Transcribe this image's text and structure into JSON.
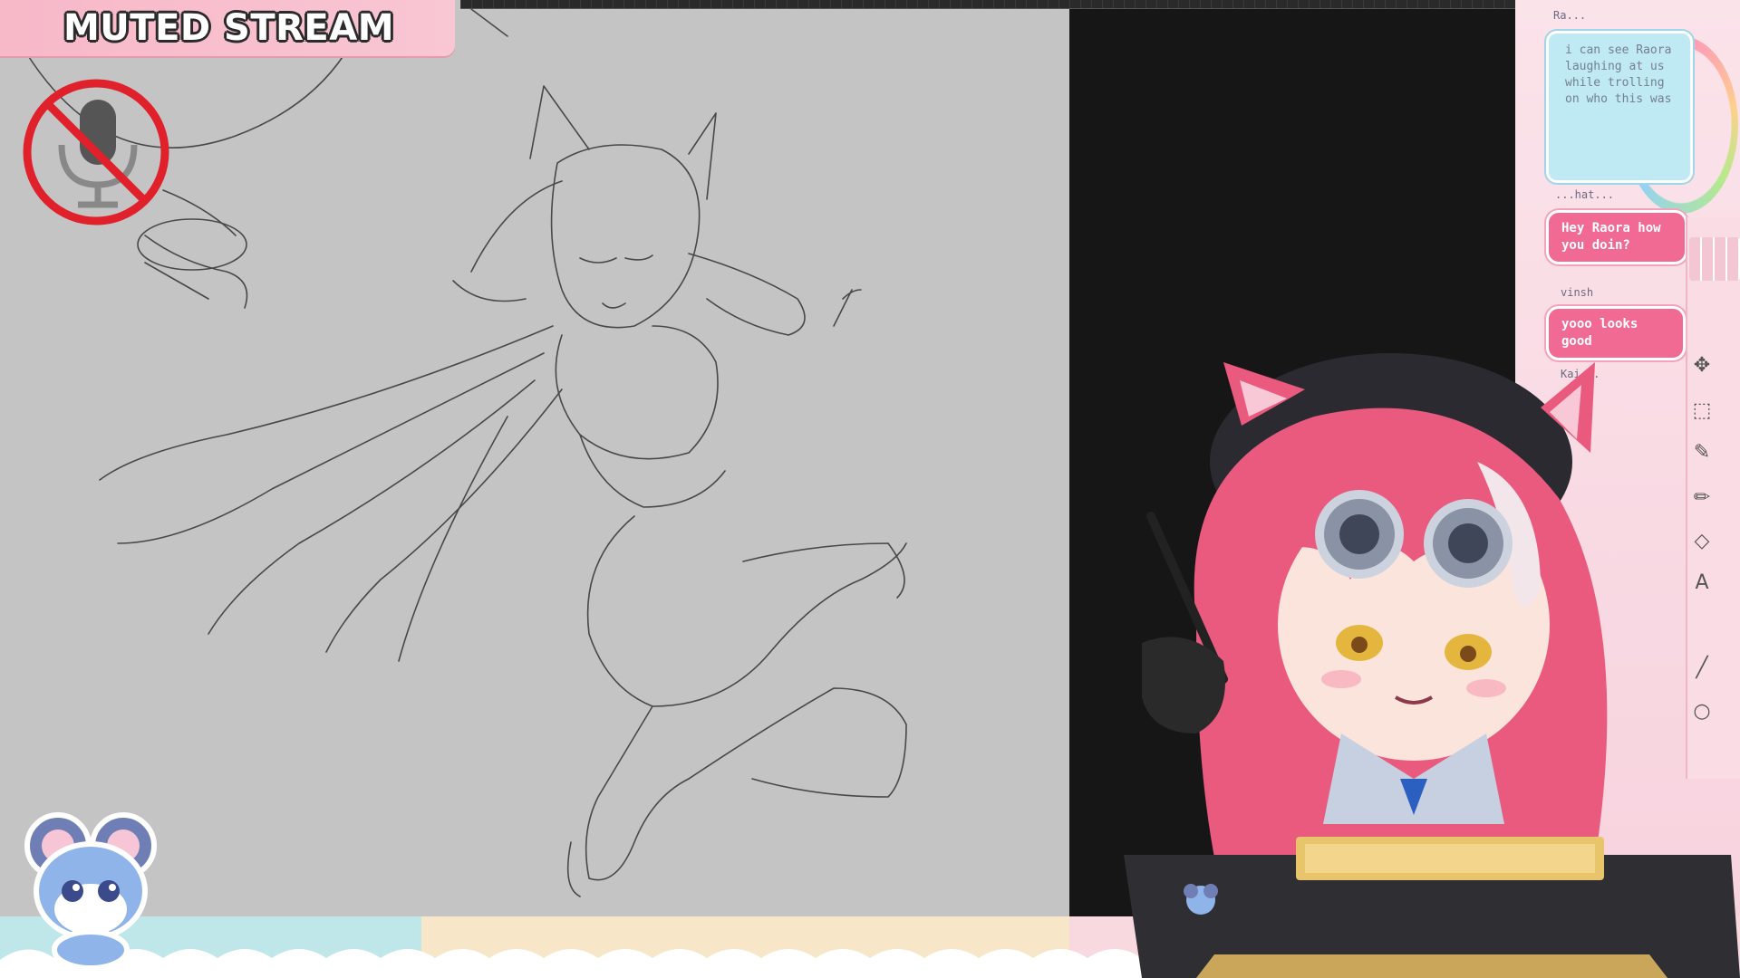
{
  "banner": {
    "text": "MUTED STREAM"
  },
  "chat": {
    "card": {
      "user": "Ra...",
      "message": "i can see Raora laughing at us while trolling on who this was"
    },
    "messages": [
      {
        "user": "...hat...",
        "text": "Hey Raora how you doin?"
      },
      {
        "user": "vinsh",
        "text": "yooo looks good"
      },
      {
        "user": "Kai...",
        "text": ""
      }
    ]
  },
  "icons": {
    "muted": "microphone-muted-icon",
    "mascot": "blue-mouse-mascot",
    "tools": [
      "move-icon",
      "select-rect-icon",
      "eyedropper-icon",
      "pen-icon",
      "eraser-icon",
      "text-icon",
      "line-icon",
      "circle-icon"
    ]
  },
  "colors": {
    "banner": "#f7b8c8",
    "canvas": "#c4c4c4",
    "chat_bubble": "#f06a93",
    "chat_card": "#bfe9f3",
    "hair": "#e95a7e"
  }
}
